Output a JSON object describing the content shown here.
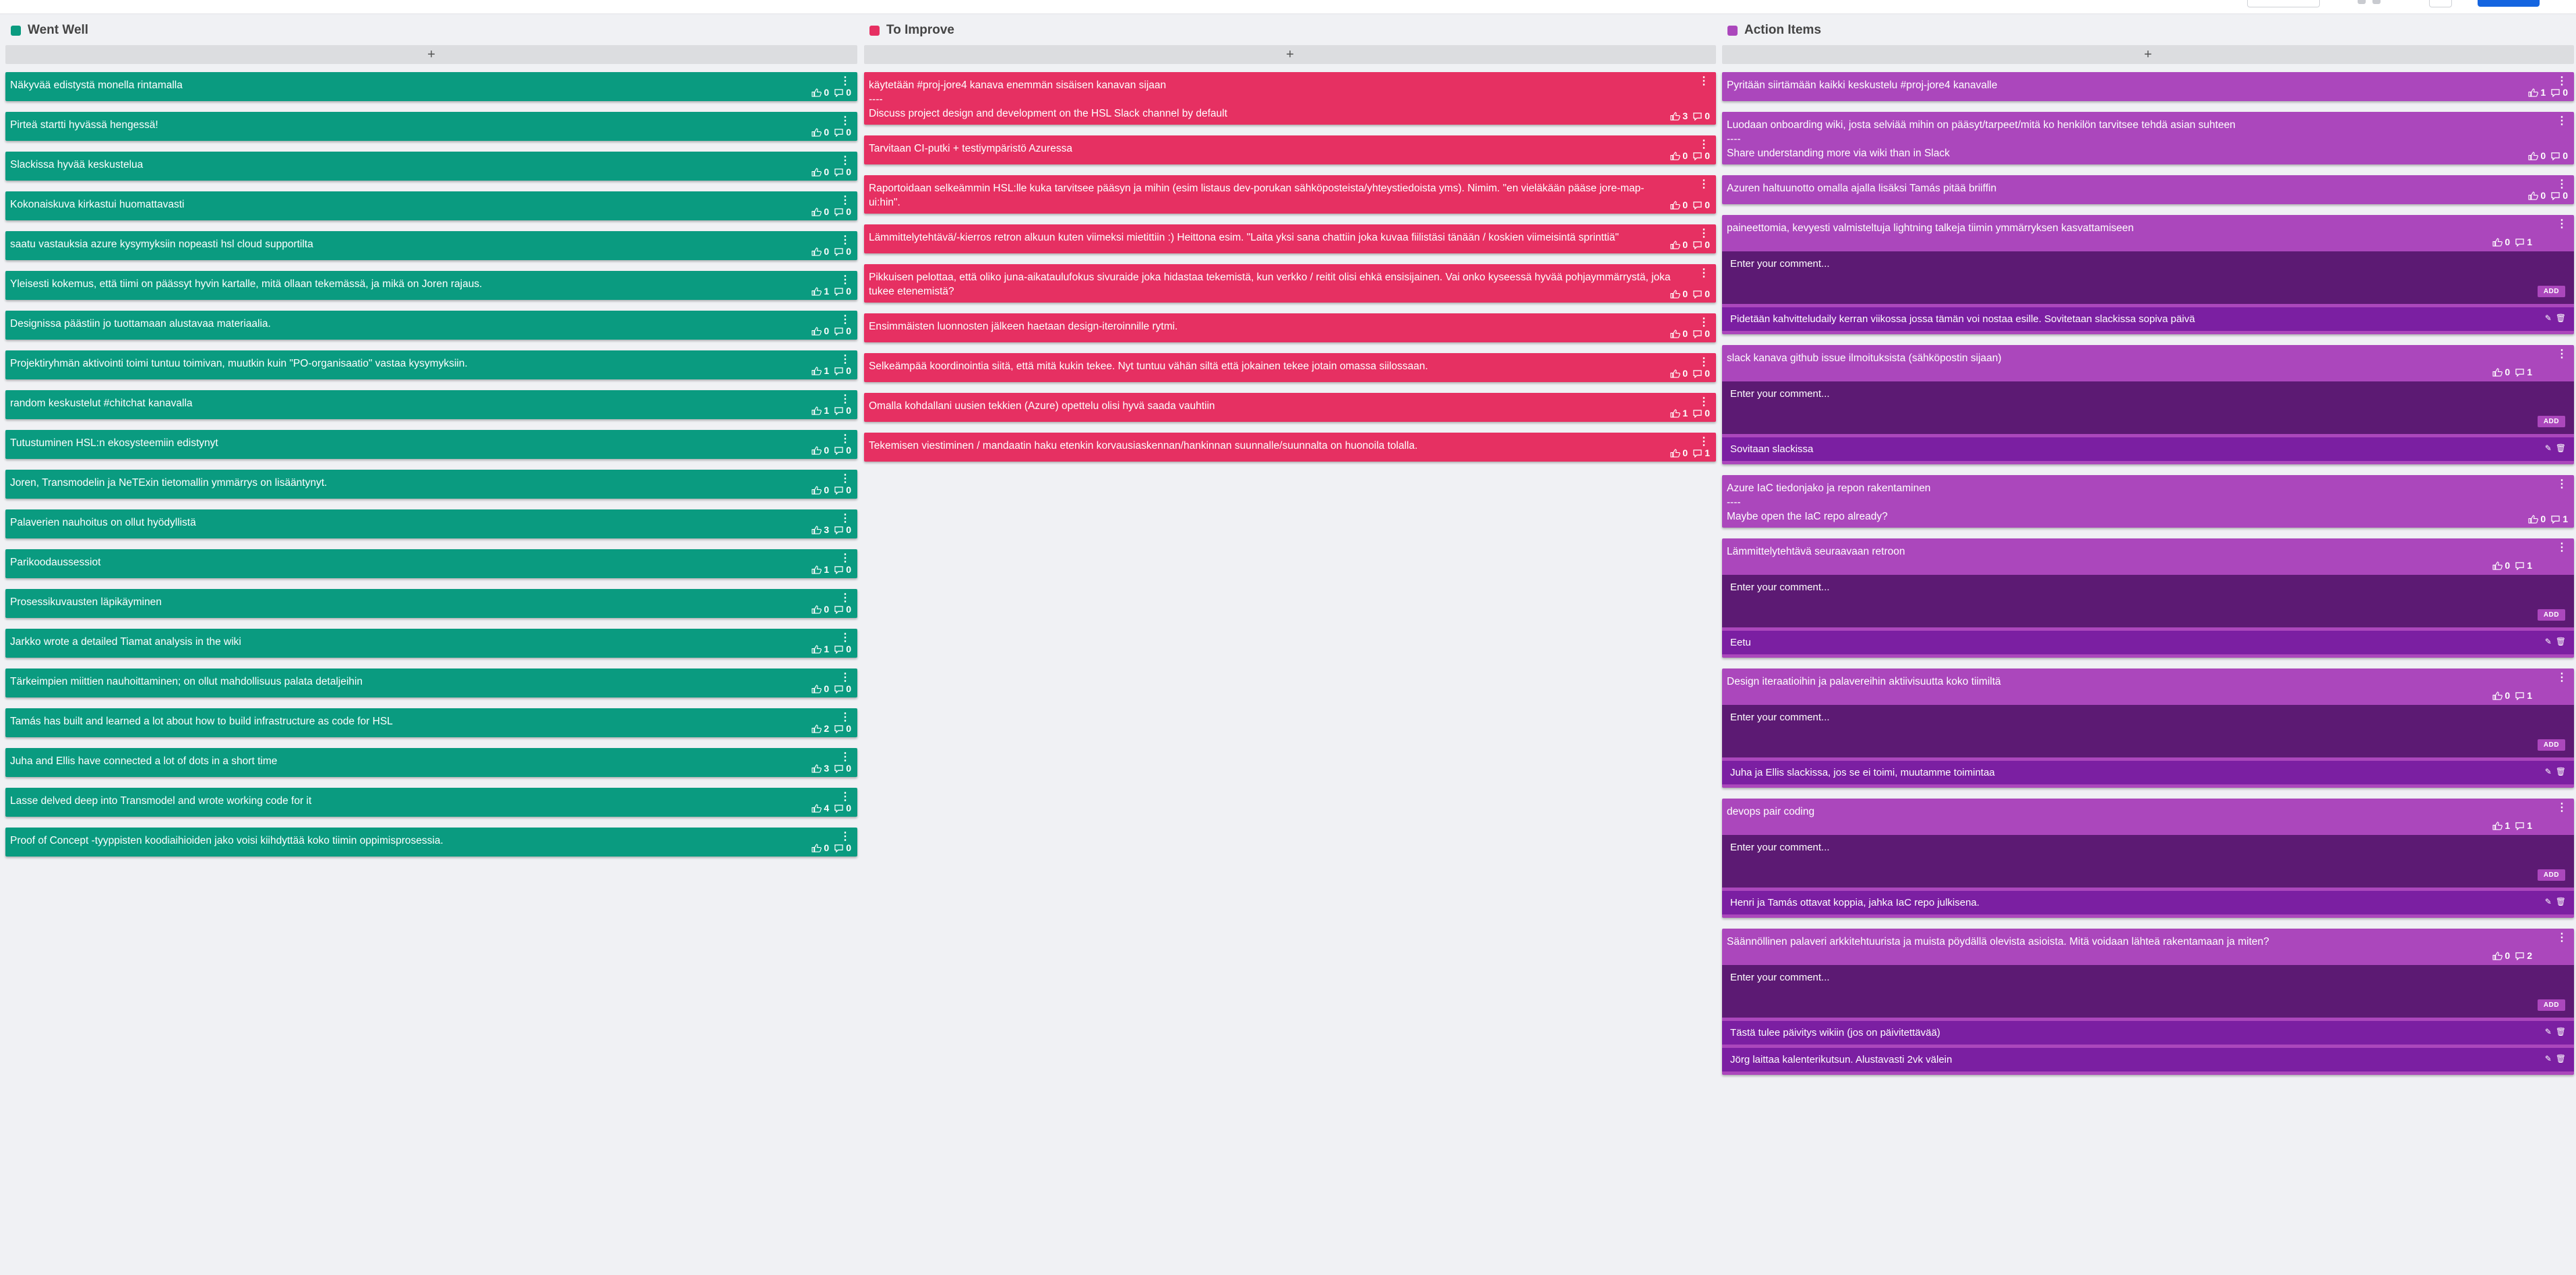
{
  "toolbar": {},
  "columns": {
    "went_well": {
      "title": "Went Well",
      "color": "#0a9b80",
      "add_label": "+",
      "cards": [
        {
          "text": "Näkyvää edistystä monella rintamalla",
          "likes": "0",
          "comments": "0"
        },
        {
          "text": "Pirteä startti hyvässä hengessä!",
          "likes": "0",
          "comments": "0"
        },
        {
          "text": "Slackissa hyvää keskustelua",
          "likes": "0",
          "comments": "0"
        },
        {
          "text": "Kokonaiskuva kirkastui huomattavasti",
          "likes": "0",
          "comments": "0"
        },
        {
          "text": "saatu vastauksia azure kysymyksiin nopeasti hsl cloud supportilta",
          "likes": "0",
          "comments": "0"
        },
        {
          "text": "Yleisesti kokemus, että tiimi on päässyt hyvin kartalle, mitä ollaan tekemässä, ja mikä on Joren rajaus.",
          "likes": "1",
          "comments": "0"
        },
        {
          "text": "Designissa päästiin jo tuottamaan alustavaa materiaalia.",
          "likes": "0",
          "comments": "0"
        },
        {
          "text": "Projektiryhmän aktivointi toimi tuntuu toimivan, muutkin kuin \"PO-organisaatio\" vastaa kysymyksiin.",
          "likes": "1",
          "comments": "0"
        },
        {
          "text": "random keskustelut #chitchat kanavalla",
          "likes": "1",
          "comments": "0"
        },
        {
          "text": "Tutustuminen HSL:n ekosysteemiin edistynyt",
          "likes": "0",
          "comments": "0"
        },
        {
          "text": "Joren, Transmodelin ja NeTExin tietomallin ymmärrys on lisääntynyt.",
          "likes": "0",
          "comments": "0"
        },
        {
          "text": "Palaverien nauhoitus on ollut hyödyllistä",
          "likes": "3",
          "comments": "0"
        },
        {
          "text": "Parikoodaussessiot",
          "likes": "1",
          "comments": "0"
        },
        {
          "text": "Prosessikuvausten läpikäyminen",
          "likes": "0",
          "comments": "0"
        },
        {
          "text": "Jarkko wrote a detailed Tiamat analysis in the wiki",
          "likes": "1",
          "comments": "0"
        },
        {
          "text": "Tärkeimpien miittien nauhoittaminen; on ollut mahdollisuus palata detaljeihin",
          "likes": "0",
          "comments": "0"
        },
        {
          "text": "Tamás has built and learned a lot about how to build infrastructure as code for HSL",
          "likes": "2",
          "comments": "0"
        },
        {
          "text": "Juha and Ellis have connected a lot of dots in a short time",
          "likes": "3",
          "comments": "0"
        },
        {
          "text": "Lasse delved deep into Transmodel and wrote working code for it",
          "likes": "4",
          "comments": "0"
        },
        {
          "text": "Proof of Concept -tyyppisten koodiaihioiden jako voisi kiihdyttää koko tiimin oppimisprosessia.",
          "likes": "0",
          "comments": "0"
        }
      ]
    },
    "to_improve": {
      "title": "To Improve",
      "color": "#e63062",
      "add_label": "+",
      "cards": [
        {
          "text": "käytetään #proj-jore4 kanava enemmän sisäisen kanavan sijaan\n----\nDiscuss project design and development on the HSL Slack channel by default",
          "likes": "3",
          "comments": "0"
        },
        {
          "text": "Tarvitaan CI-putki + testiympäristö Azuressa",
          "likes": "0",
          "comments": "0"
        },
        {
          "text": "Raportoidaan selkeämmin HSL:lle kuka tarvitsee pääsyn ja mihin (esim listaus dev-porukan sähköposteista/yhteystiedoista yms). Nimim. \"en vieläkään pääse jore-map-ui:hin\".",
          "likes": "0",
          "comments": "0"
        },
        {
          "text": "Lämmittelytehtävä/-kierros retron alkuun kuten viimeksi mietittiin :) Heittona esim. \"Laita yksi sana chattiin joka kuvaa fiilistäsi tänään / koskien viimeisintä sprinttiä\"",
          "likes": "0",
          "comments": "0"
        },
        {
          "text": "Pikkuisen pelottaa, että oliko juna-aikataulufokus sivuraide joka hidastaa tekemistä, kun verkko / reitit olisi ehkä ensisijainen. Vai onko kyseessä hyvää pohjaymmärrystä, joka tukee etenemistä?",
          "likes": "0",
          "comments": "0"
        },
        {
          "text": "Ensimmäisten luonnosten jälkeen haetaan design-iteroinnille rytmi.",
          "likes": "0",
          "comments": "0"
        },
        {
          "text": "Selkeämpää koordinointia siitä, että mitä kukin tekee. Nyt tuntuu vähän siltä että jokainen tekee jotain omassa siilossaan.",
          "likes": "0",
          "comments": "0"
        },
        {
          "text": "Omalla kohdallani uusien tekkien (Azure) opettelu olisi hyvä saada vauhtiin",
          "likes": "1",
          "comments": "0"
        },
        {
          "text": "Tekemisen viestiminen / mandaatin haku etenkin korvausiaskennan/hankinnan suunnalle/suunnalta on huonoila tolalla.",
          "likes": "0",
          "comments": "1"
        }
      ]
    },
    "action_items": {
      "title": "Action Items",
      "color": "#ab47bc",
      "add_label": "+",
      "comment_placeholder": "Enter your comment...",
      "comment_add_label": "ADD",
      "cards": [
        {
          "text": "Pyritään siirtämään kaikki keskustelu #proj-jore4 kanavalle",
          "likes": "1",
          "comments": "0",
          "thread": []
        },
        {
          "text": "Luodaan onboarding wiki, josta selviää mihin on pääsyt/tarpeet/mitä ko henkilön tarvitsee tehdä asian suhteen\n----\nShare understanding more via wiki than in Slack",
          "likes": "0",
          "comments": "0",
          "thread": []
        },
        {
          "text": "Azuren haltuunotto omalla ajalla lisäksi Tamás pitää briiffin",
          "likes": "0",
          "comments": "0",
          "thread": []
        },
        {
          "text": "paineettomia, kevyesti valmisteltuja lightning talkeja tiimin ymmärryksen kasvattamiseen",
          "likes": "0",
          "comments": "1",
          "thread": [
            "Pidetään kahvitteludaily kerran viikossa jossa tämän voi nostaa esille. Sovitetaan slackissa sopiva päivä"
          ]
        },
        {
          "text": "slack kanava github issue ilmoituksista (sähköpostin sijaan)",
          "likes": "0",
          "comments": "1",
          "thread": [
            "Sovitaan slackissa"
          ]
        },
        {
          "text": "Azure IaC tiedonjako ja repon rakentaminen\n----\nMaybe open the IaC repo already?",
          "likes": "0",
          "comments": "1",
          "thread": []
        },
        {
          "text": "Lämmittelytehtävä seuraavaan retroon",
          "likes": "0",
          "comments": "1",
          "thread": [
            "Eetu"
          ]
        },
        {
          "text": "Design iteraatioihin ja palavereihin aktiivisuutta koko tiimiltä",
          "likes": "0",
          "comments": "1",
          "thread": [
            "Juha ja Ellis slackissa, jos se ei toimi, muutamme toimintaa"
          ]
        },
        {
          "text": "devops pair coding",
          "likes": "1",
          "comments": "1",
          "thread": [
            "Henri ja Tamás ottavat koppia, jahka IaC repo julkisena."
          ]
        },
        {
          "text": "Säännöllinen palaveri arkkitehtuurista ja muista pöydällä olevista asioista. Mitä voidaan lähteä rakentamaan ja miten?",
          "likes": "0",
          "comments": "2",
          "thread": [
            "Tästä tulee päivitys wikiin (jos on päivitettävää)",
            "Jörg laittaa kalenterikutsun. Alustavasti 2vk välein"
          ]
        }
      ]
    }
  },
  "icons": {
    "like": "thumbs-up-icon",
    "comment": "comment-icon",
    "menu": "vertical-dots-icon",
    "edit": "pencil-icon",
    "delete": "trash-icon"
  }
}
